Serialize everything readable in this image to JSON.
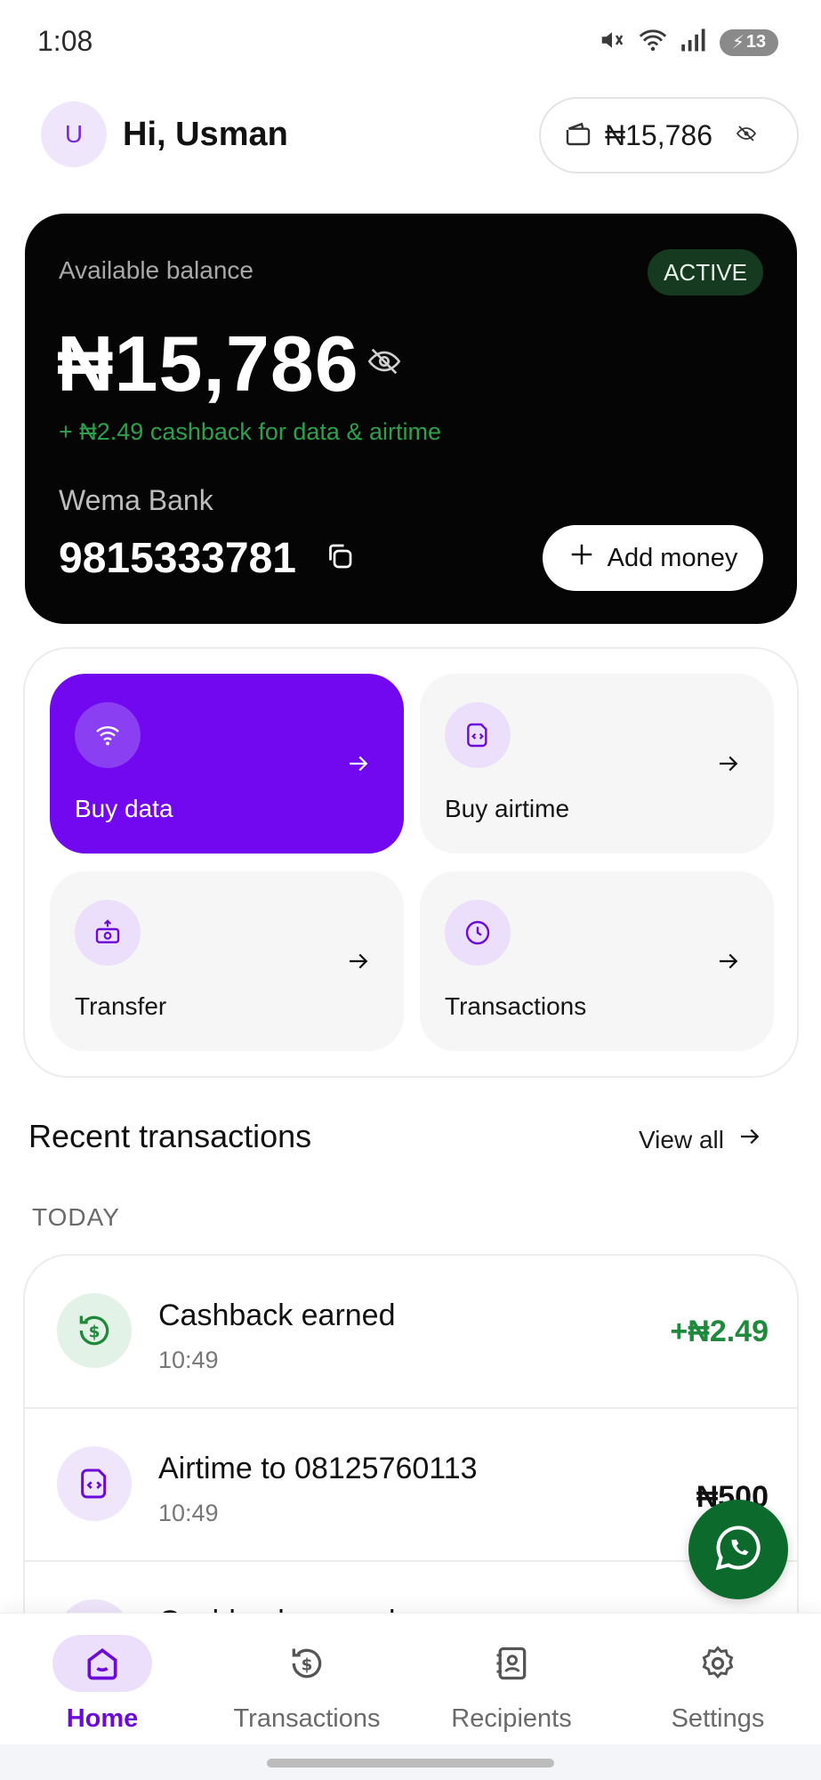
{
  "status_bar": {
    "time": "1:08",
    "battery": "13"
  },
  "header": {
    "avatar_initial": "U",
    "greeting": "Hi, Usman",
    "balance_pill_amount": "₦15,786"
  },
  "balance_card": {
    "label": "Available balance",
    "status": "ACTIVE",
    "balance": "₦15,786",
    "cashback_note": "+ ₦2.49 cashback for data & airtime",
    "bank_name": "Wema Bank",
    "account_number": "9815333781",
    "add_money_label": "Add money"
  },
  "actions": [
    {
      "label": "Buy data",
      "icon": "wifi-icon"
    },
    {
      "label": "Buy airtime",
      "icon": "sim-card-icon"
    },
    {
      "label": "Transfer",
      "icon": "money-transfer-icon"
    },
    {
      "label": "Transactions",
      "icon": "clock-icon"
    }
  ],
  "recent": {
    "title": "Recent transactions",
    "view_all": "View all",
    "day_label": "TODAY",
    "items": [
      {
        "title": "Cashback earned",
        "time": "10:49",
        "amount": "+₦2.49",
        "icon": "cashback-icon",
        "amount_color": "#1f8a3b"
      },
      {
        "title": "Airtime to 08125760113",
        "time": "10:49",
        "amount": "₦500",
        "icon": "sim-card-icon",
        "amount_color": "#111111"
      },
      {
        "title": "Cashback earned",
        "time": "",
        "amount": "",
        "icon": "cashback-icon",
        "amount_color": "#1f8a3b"
      }
    ]
  },
  "nav": [
    {
      "label": "Home",
      "icon": "home-icon",
      "active": true
    },
    {
      "label": "Transactions",
      "icon": "dollar-history-icon",
      "active": false
    },
    {
      "label": "Recipients",
      "icon": "contacts-icon",
      "active": false
    },
    {
      "label": "Settings",
      "icon": "gear-icon",
      "active": false
    }
  ],
  "colors": {
    "brand_purple": "#7108f0",
    "success_green": "#1f8a3b",
    "whatsapp_green": "#0c6b2c"
  }
}
